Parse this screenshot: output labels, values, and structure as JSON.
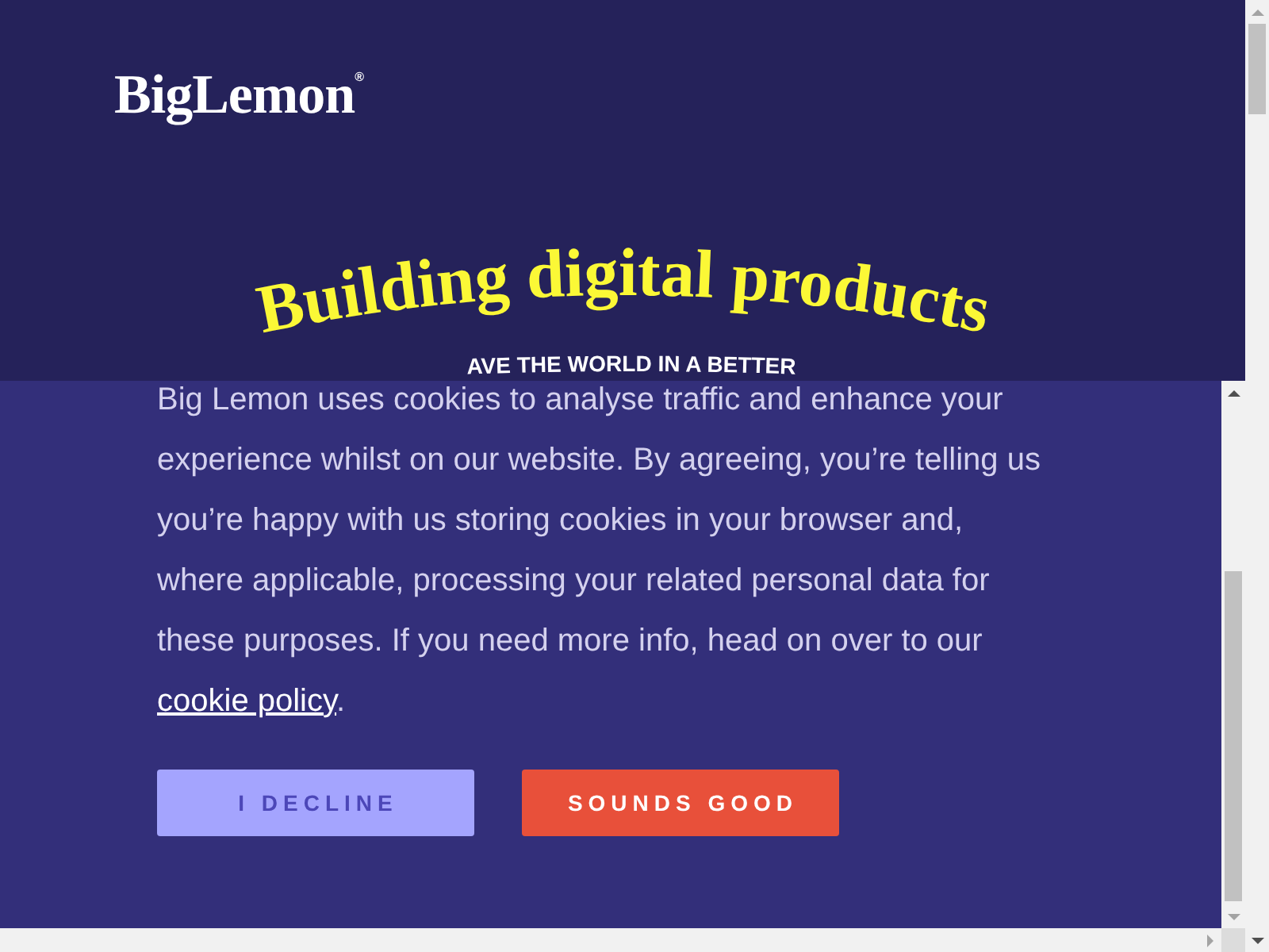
{
  "header": {
    "logo": "BigLemon$^{®}$",
    "headline": "Building digital products",
    "tagline": "AVE THE WORLD IN A BETTER"
  },
  "cookie_notice": {
    "lines": [
      "Big Lemon uses cookies to analyse traffic and enhance your",
      "experience whilst on our website. By agreeing, you’re telling us",
      "you’re happy with us storing cookies in your browser and,",
      "where applicable, processing your related personal data for",
      "these purposes. If you need more info, head on over to our"
    ],
    "link": "cookie policy",
    "text_after": ".",
    "buttons": [
      {
        "label": "I DECLINE",
        "kind": "secondary"
      },
      {
        "label": "SOUNDS GOOD",
        "kind": "primary"
      }
    ]
  }
}
